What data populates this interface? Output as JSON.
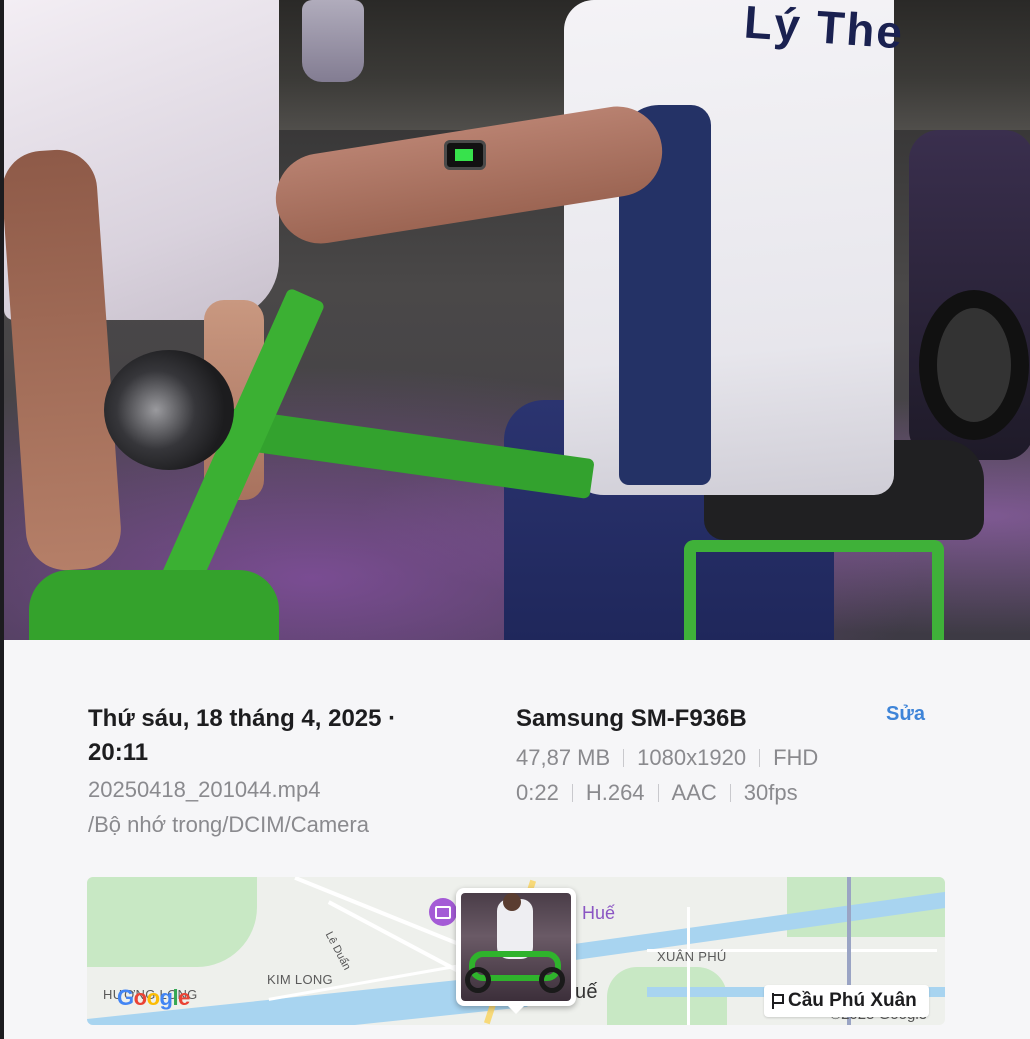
{
  "info": {
    "date_time": "Thứ sáu, 18 tháng 4, 2025 · 20:11",
    "file_name": "20250418_201044.mp4",
    "file_path": "/Bộ nhớ trong/DCIM/Camera",
    "device": "Samsung SM-F936B",
    "edit_label": "Sửa",
    "specs_row1": [
      "47,87 MB",
      "1080x1920",
      "FHD"
    ],
    "specs_row2": [
      "0:22",
      "H.264",
      "AAC",
      "30fps"
    ]
  },
  "map": {
    "place_label": "Cầu Phú Xuân",
    "district_labels": [
      "KIM LONG",
      "XUÂN PHÚ",
      "HƯƠNG LONG"
    ],
    "street_label": "Lê Duẩn",
    "city_label_left": "nh Huế",
    "city_label_bottom": "uế",
    "logo_letters": [
      "G",
      "o",
      "o",
      "g",
      "l",
      "e"
    ],
    "copyright": "©2025 Google",
    "colors": {
      "river": "#a8d4f0",
      "park": "#c8e8c4",
      "pin": "#a45bd6"
    }
  },
  "frame": {
    "shirt_text": "Lý The"
  }
}
